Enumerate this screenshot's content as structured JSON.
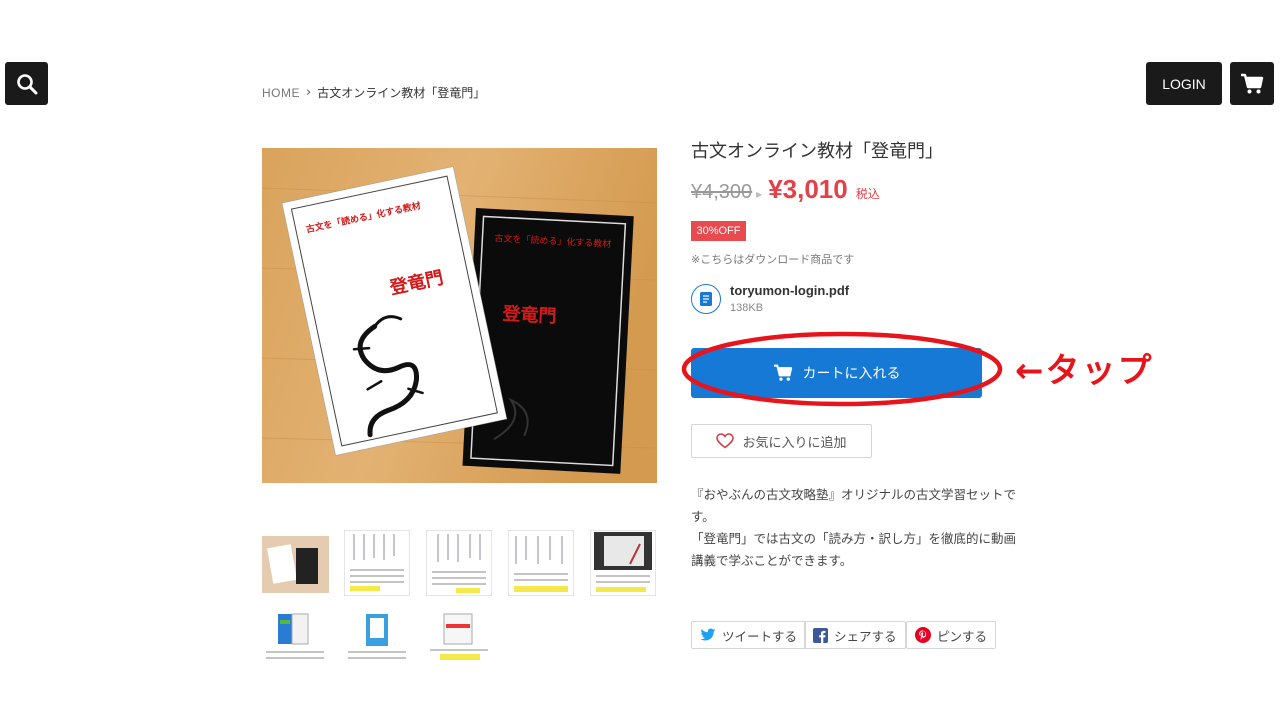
{
  "header": {
    "search_icon": "search-icon",
    "login_label": "LOGIN",
    "cart_icon": "cart-icon"
  },
  "breadcrumb": {
    "home": "HOME",
    "separator": "›",
    "current": "古文オンライン教材「登竜門」"
  },
  "product": {
    "title": "古文オンライン教材「登竜門」",
    "old_price": "¥4,300",
    "new_price": "¥3,010",
    "tax_label": "税込",
    "badge": "30%OFF",
    "download_note": "※こちらはダウンロード商品です",
    "file": {
      "name": "toryumon-login.pdf",
      "size": "138KB"
    },
    "add_to_cart": "カートに入れる",
    "favorite": "お気に入りに追加",
    "description": [
      "『おやぶんの古文攻略塾』オリジナルの古文学習セットで",
      "す。",
      "「登竜門」では古文の「読み方・訳し方」を徹底的に動画",
      "講義で学ぶことができます。"
    ]
  },
  "image": {
    "white_cover_heading": "古文を「読める」化する教材",
    "white_cover_title": "登竜門",
    "black_cover_heading": "古文を「読める」化する教材",
    "black_cover_title": "登竜門"
  },
  "annotation": {
    "tap_label": "←タップ"
  },
  "share": {
    "tweet": "ツイートする",
    "facebook": "シェアする",
    "pin": "ピンする"
  },
  "colors": {
    "accent_blue": "#1779d6",
    "price_red": "#e2414a",
    "annotation_red": "#e8141b",
    "header_dark": "#1a1a1a"
  }
}
